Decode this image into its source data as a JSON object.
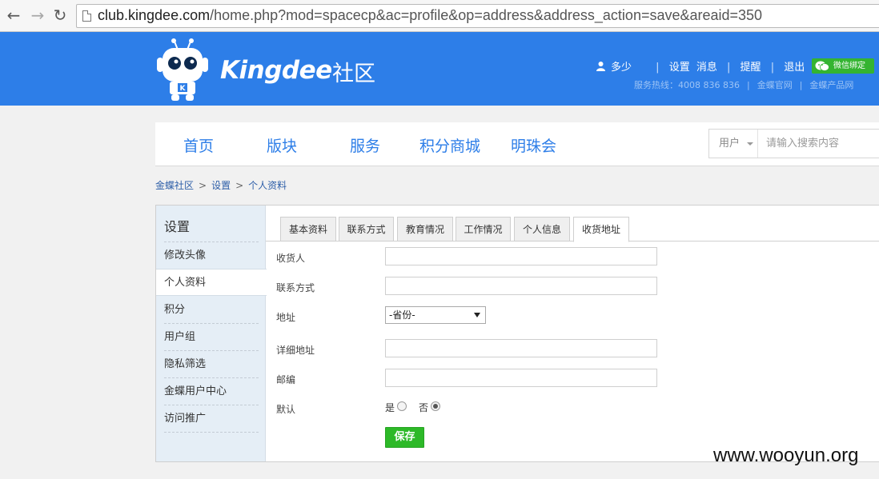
{
  "browser": {
    "url_host": "club.kingdee.com",
    "url_rest": "/home.php?mod=spacecp&ac=profile&op=address&address_action=save&areaid=350"
  },
  "header": {
    "robot_badge": "K",
    "brand": "Kingdee",
    "brand_cn": "社区",
    "username": "多少",
    "links": [
      "设置",
      "消息",
      "提醒",
      "退出"
    ],
    "wechat_label": "微信绑定",
    "hotline_text": "服务热线：4008 836 836",
    "official_site": "金蝶官网",
    "product_site": "金蝶产品网"
  },
  "nav": {
    "items": [
      "首页",
      "版块",
      "服务",
      "积分商城",
      "明珠会"
    ],
    "search_scope": "用户",
    "search_placeholder": "请输入搜索内容"
  },
  "breadcrumb": [
    "金蝶社区",
    "设置",
    "个人资料"
  ],
  "sidebar": {
    "title": "设置",
    "items": [
      "修改头像",
      "个人资料",
      "积分",
      "用户组",
      "隐私筛选",
      "金蝶用户中心",
      "访问推广"
    ]
  },
  "tabs": [
    "基本资料",
    "联系方式",
    "教育情况",
    "工作情况",
    "个人信息",
    "收货地址"
  ],
  "form": {
    "receiver_label": "收货人",
    "contact_label": "联系方式",
    "address_label": "地址",
    "province_select": "-省份-",
    "detail_label": "详细地址",
    "zip_label": "邮编",
    "default_label": "默认",
    "yes_label": "是",
    "no_label": "否",
    "default_value": "否",
    "save_label": "保存"
  },
  "watermark": "www.wooyun.org",
  "colors": {
    "header_bg": "#2d7ee8",
    "link_blue": "#2d7ee8",
    "save_green": "#2db928",
    "sidebar_bg": "#e5eef6"
  }
}
